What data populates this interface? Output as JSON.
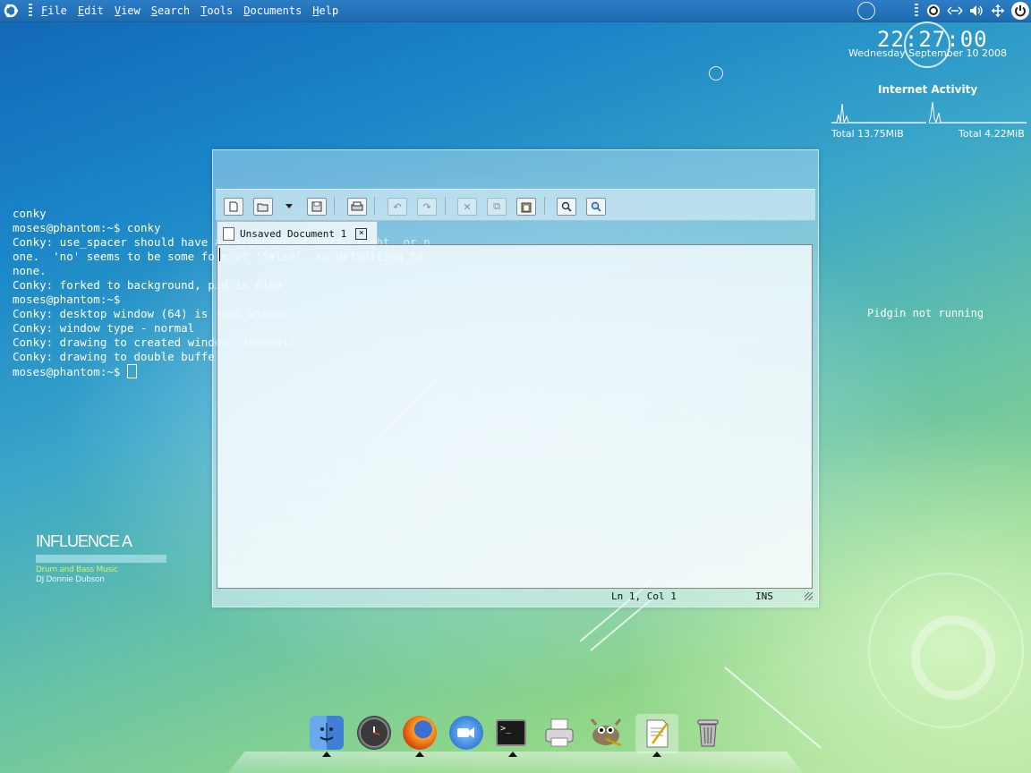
{
  "top_panel": {
    "menus": [
      "File",
      "Edit",
      "View",
      "Search",
      "Tools",
      "Documents",
      "Help"
    ],
    "tray_icons": [
      "update-icon",
      "network-icon",
      "volume-icon",
      "network-manager-icon",
      "power-icon"
    ]
  },
  "conky": {
    "time": "22:27:00",
    "date": "Wednesday September 10 2008",
    "net_title": "Internet Activity",
    "total_down": "Total 13.75MiB",
    "total_up": "Total 4.22MiB",
    "pidgin": "Pidgin not running"
  },
  "terminal": {
    "lines": [
      "conky",
      "moses@phantom:~$ conky",
      "Conky: use_spacer should have an argument of left, right, or n",
      "one.  'no' seems to be some form of 'false', so defaulting to",
      "none.",
      "Conky: forked to background, pid is 6189",
      "moses@phantom:~$",
      "Conky: desktop window (64) is root window",
      "Conky: window type - normal",
      "Conky: drawing to created window (3600001)",
      "Conky: drawing to double buffer"
    ],
    "prompt": "moses@phantom:~$ "
  },
  "album": {
    "title": "INFLUENCE A",
    "genre": "Drum and Bass Music",
    "artist": "DJ Donnie Dubson"
  },
  "gedit": {
    "tab_title": "Unsaved Document 1",
    "status_position": "Ln 1, Col 1",
    "status_mode": "INS"
  },
  "dock": {
    "items": [
      "Finder",
      "Clock",
      "Firefox",
      "Chat",
      "Terminal",
      "Printer",
      "GIMP",
      "Text Editor",
      "Trash"
    ]
  }
}
